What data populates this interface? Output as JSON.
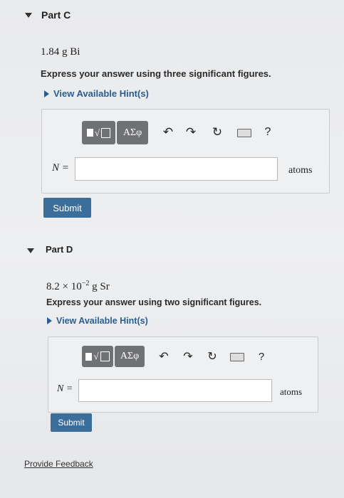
{
  "part_c": {
    "title": "Part C",
    "question": "1.84 g Bi",
    "instruction": "Express your answer using three significant figures.",
    "hint_label": "View Available Hint(s)",
    "toolbar": {
      "greek": "ΑΣφ",
      "help": "?"
    },
    "variable": "N =",
    "input_value": "",
    "unit": "atoms",
    "submit_label": "Submit"
  },
  "part_d": {
    "title": "Part D",
    "question_mantissa": "8.2 × 10",
    "question_exponent": "−2",
    "question_rest": " g Sr",
    "instruction": "Express your answer using two significant figures.",
    "hint_label": "View Available Hint(s)",
    "toolbar": {
      "greek": "ΑΣφ",
      "help": "?"
    },
    "variable": "N =",
    "input_value": "",
    "unit": "atoms",
    "submit_label": "Submit"
  },
  "footer": {
    "feedback_label": "Provide Feedback"
  },
  "colors": {
    "submit_bg": "#3c6e9c",
    "hint_text": "#2a5d8f",
    "toolbar_bg": "#707175"
  }
}
